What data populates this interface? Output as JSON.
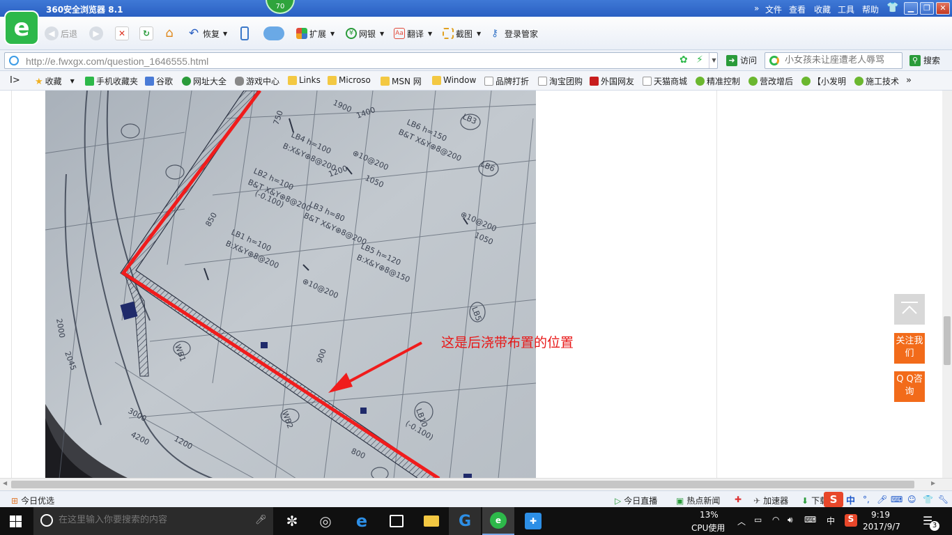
{
  "browser": {
    "title": "360安全浏览器 8.1",
    "score": "70",
    "menu": [
      "文件",
      "查看",
      "收藏",
      "工具",
      "帮助"
    ],
    "toolbar": {
      "back": "后退",
      "restore": "恢复",
      "extend": "扩展",
      "bank": "网银",
      "translate": "翻译",
      "screenshot": "截图",
      "login": "登录管家"
    },
    "address": {
      "url": "http://e.fwxgx.com/question_1646555.html",
      "go": "访问"
    },
    "search": {
      "placeholder": "小女孩未让座遭老人辱骂",
      "button": "搜索"
    },
    "favorites": [
      "收藏",
      "手机收藏夹",
      "谷歌",
      "网址大全",
      "游戏中心",
      "Links",
      "Microso",
      "MSN 网",
      "Window",
      "品牌打折",
      "淘宝团购",
      "外国网友",
      "天猫商城",
      "精准控制",
      "营改增后",
      "【小发明",
      "施工技术"
    ]
  },
  "page": {
    "annotation": "这是后浇带布置的位置",
    "float_buttons": {
      "follow": "关注我们",
      "qq": "Q Q咨询"
    }
  },
  "drawing_labels": [
    "LB4 h=100",
    "B:X&Y⊕8@200",
    "LB6 h=150",
    "B&T X&Y⊕8@200",
    "LB2 h=100",
    "B&T X&Y⊕8@200",
    "(-0.100)",
    "LB3 h=80",
    "B&T X&Y⊕8@200",
    "LB1 h=100",
    "B:X&Y⊕8@200",
    "LB5 h=120",
    "B:X&Y⊕8@150",
    "LB5",
    "LB6",
    "LB3",
    "LB10",
    "(-0.100)",
    "WB1",
    "WB2",
    "⊕10@200",
    "⊕10@200",
    "⊕10@200",
    "1200",
    "1400",
    "1900",
    "3000",
    "4200",
    "1200",
    "2045",
    "2000",
    "1050",
    "1050",
    "850",
    "900",
    "800",
    "750"
  ],
  "statusbar": {
    "today": "今日优选",
    "live": "今日直播",
    "hot": "热点新闻",
    "accelerate": "加速器",
    "download": "下载",
    "ime": "中"
  },
  "taskbar": {
    "search_placeholder": "在这里输入你要搜索的内容",
    "cpu_percent": "13%",
    "cpu_label": "CPU使用",
    "lang": "中",
    "time": "9:19",
    "date": "2017/9/7",
    "notifications": "3"
  },
  "colors": {
    "titlebar": "#2a5fc2",
    "accent_orange": "#f26b1a",
    "annotation_red": "#e81818",
    "taskbar": "#101010"
  }
}
